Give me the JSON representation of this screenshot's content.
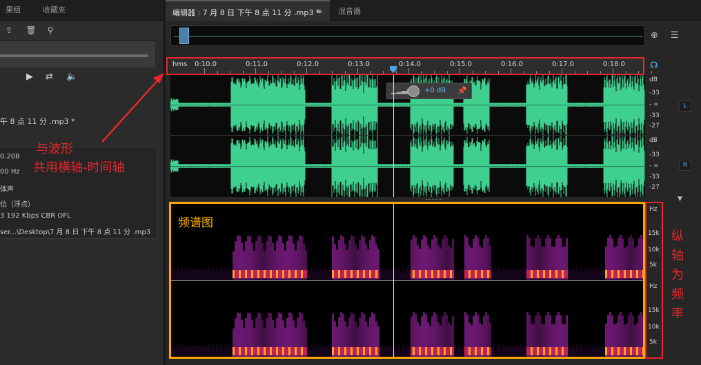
{
  "left_panel": {
    "tabs": [
      "果组",
      "收藏夹"
    ],
    "file_title": "午 8 点 11 分 .mp3 *",
    "properties": [
      "0.208",
      "00 Hz",
      "体声",
      "位（浮点）",
      "3 192 Kbps CBR OFL",
      "ser...\\Desktop\\7 月 8 日 下午 8 点 11 分 .mp3"
    ],
    "toolbar_icons": [
      "import-icon",
      "trash-icon",
      "search-icon"
    ],
    "transport_icons": [
      "play-icon",
      "loop-export-icon",
      "speaker-icon"
    ]
  },
  "editor": {
    "tab_label": "编辑器 : 7 月 8 日 下午 8 点 11 分 .mp3 *",
    "tab_menu": "≡",
    "second_tab": "混音器",
    "ruler": {
      "unit": "hms",
      "ticks": [
        "0:10.0",
        "0:11.0",
        "0:12.0",
        "0:13.0",
        "0:14.0",
        "0:15.0",
        "0:16.0",
        "0:17.0",
        "0:18.0"
      ]
    },
    "gain_hud": "+0 dB",
    "db_scale_L": [
      "dB",
      "-33",
      "- ∞",
      "-33",
      "-27"
    ],
    "db_scale_R": [
      "dB",
      "-33",
      "- ∞",
      "-33",
      "-27"
    ],
    "channels": [
      "L",
      "R"
    ],
    "hz_scale_top": [
      "Hz",
      "15k",
      "10k",
      "5k"
    ],
    "hz_scale_bottom": [
      "Hz",
      "15k",
      "10k",
      "5k"
    ]
  },
  "annotations": {
    "ruler_note_line1": "与波形",
    "ruler_note_line2": "共用横轴-时间轴",
    "spectral_title": "频谱图",
    "vertical_note": "纵轴为频率"
  },
  "colors": {
    "waveform": "#3fcf8e",
    "annotation_red": "#e8262b",
    "spectral_border": "#ffa600",
    "accent_blue": "#5fb4f0"
  }
}
